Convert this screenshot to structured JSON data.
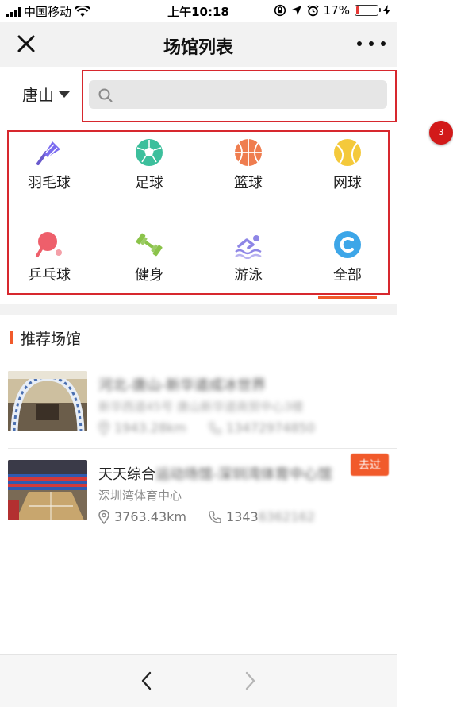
{
  "status_bar": {
    "carrier": "中国移动",
    "time": "上午10:18",
    "battery_percent": "17%",
    "battery_level": 0.17,
    "icons": [
      "signal-icon",
      "wifi-icon",
      "orientation-lock-icon",
      "location-arrow-icon",
      "alarm-icon",
      "battery-icon",
      "charging-icon"
    ]
  },
  "navbar": {
    "title": "场馆列表"
  },
  "search": {
    "city": "唐山",
    "placeholder": ""
  },
  "categories": [
    {
      "label": "羽毛球",
      "icon": "badminton-icon",
      "color": "#6a5acd"
    },
    {
      "label": "足球",
      "icon": "football-icon",
      "color": "#3cbf9c"
    },
    {
      "label": "篮球",
      "icon": "basketball-icon",
      "color": "#ef7d4f"
    },
    {
      "label": "网球",
      "icon": "tennis-icon",
      "color": "#f4c93b"
    },
    {
      "label": "乒乓球",
      "icon": "pingpong-icon",
      "color": "#ee5f6b"
    },
    {
      "label": "健身",
      "icon": "dumbbell-icon",
      "color": "#8bc34a"
    },
    {
      "label": "游泳",
      "icon": "swimming-icon",
      "color": "#8e86e6"
    },
    {
      "label": "全部",
      "icon": "all-c-icon",
      "color": "#3da6e8"
    }
  ],
  "recommended": {
    "title": "推荐场馆",
    "venues": [
      {
        "name": "河北-唐山-新华道成冰世界",
        "address": "新华西道45号 唐山新华道商贸中心3楼",
        "distance": "1943.28km",
        "phone": "13472974850",
        "blurred": true
      },
      {
        "name_visible": "天天综合",
        "name_hidden": "运动场馆-深圳湾体育中心馆",
        "address": "深圳湾体育中心",
        "distance": "3763.43km",
        "phone_visible": "1343",
        "phone_hidden": "6362162",
        "badge": "去过",
        "blurred": false
      }
    ]
  },
  "annotation": {
    "marker_label": "3"
  },
  "colors": {
    "accent": "#f15a2b",
    "highlight_box": "#d7282e",
    "marker": "#d21a1a"
  }
}
